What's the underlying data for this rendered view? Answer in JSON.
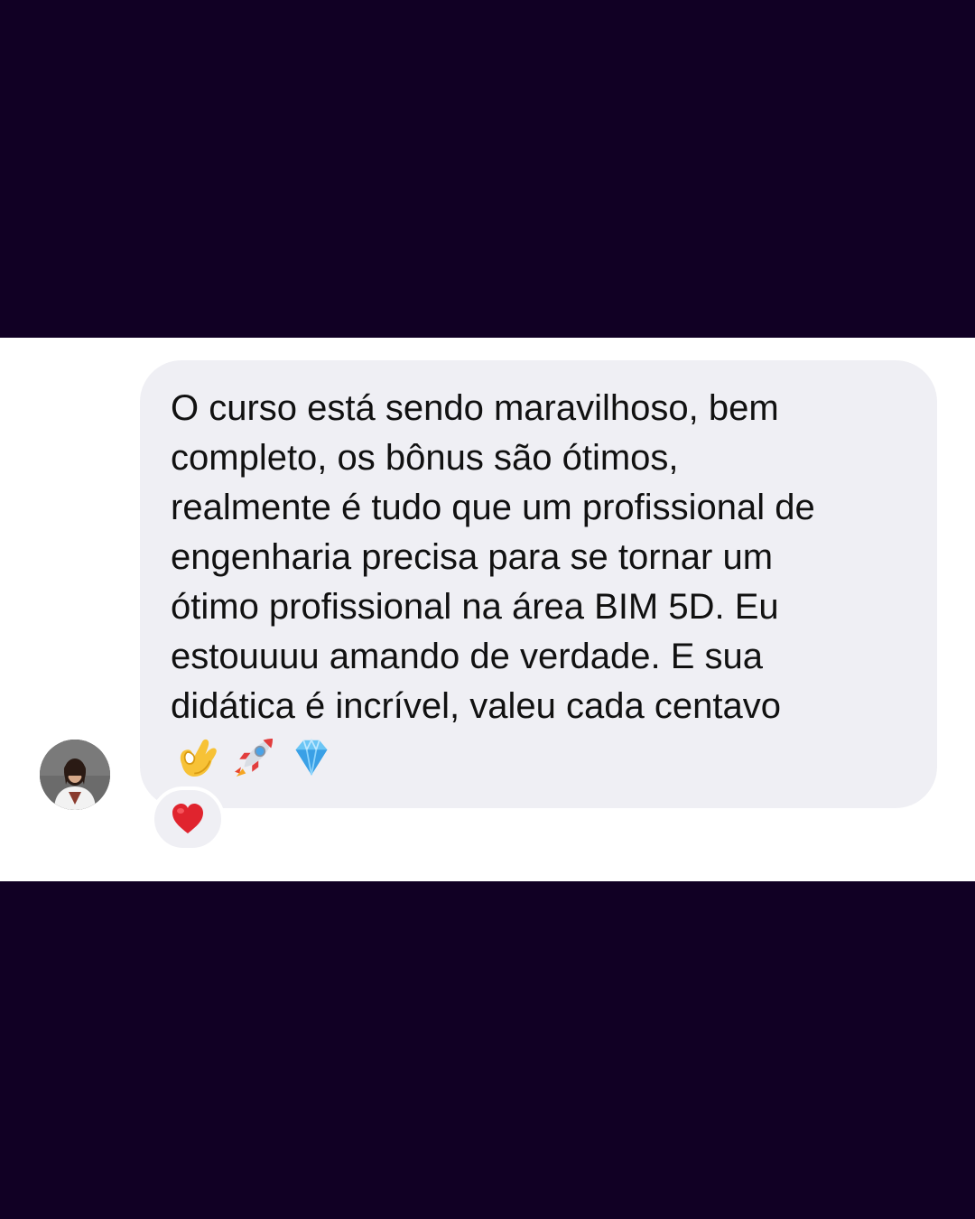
{
  "conversation": {
    "message": {
      "text": "O curso está sendo maravilhoso, bem\ncompleto, os bônus são ótimos,\nrealmente é tudo que um profissional de\nengenharia precisa para se tornar um\nótimo profissional na área BIM 5D. Eu\nestouuuu amando de verdade. E sua\ndidática é incrível, valeu cada centavo",
      "emojis": [
        "ok-hand-icon",
        "rocket-icon",
        "gem-icon"
      ]
    },
    "reaction": {
      "icon": "red-heart-icon"
    },
    "sender": {
      "avatar": "profile-photo"
    }
  },
  "colors": {
    "background": "#110024",
    "panel": "#ffffff",
    "bubble": "#efeff4",
    "text": "#111111",
    "heart": "#e0242e"
  }
}
